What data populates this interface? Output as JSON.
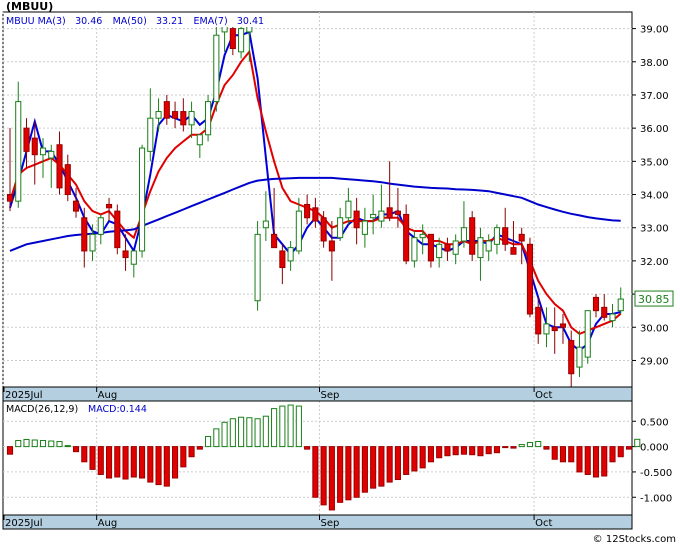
{
  "ticker": "(MBUU)",
  "copyright": "© 12Stocks.com",
  "price_legend": {
    "symbol": "MBUU",
    "ma3_label": "MA(3)",
    "ma3_value": "30.46",
    "ma50_label": "MA(50)",
    "ma50_value": "33.21",
    "ema7_label": "EMA(7)",
    "ema7_value": "30.41"
  },
  "macd_legend": {
    "params": "MACD(26,12,9)",
    "value": "MACD:0.144"
  },
  "last_price_label": "30.85",
  "colors": {
    "up": "#1a7f1a",
    "down": "#e00000",
    "ma3": "#0000dd",
    "ema7": "#e00000",
    "ma50": "#0000cc",
    "axis_band": "#b3cfe0",
    "grid": "#cccccc",
    "frame": "#000000"
  },
  "chart_data": [
    {
      "type": "candlestick",
      "title": "MBUU",
      "ylim": [
        28.2,
        39.5
      ],
      "y_ticks": [
        "29.00",
        "30.00",
        "31.00",
        "32.00",
        "33.00",
        "34.00",
        "35.00",
        "36.00",
        "37.00",
        "38.00",
        "39.00"
      ],
      "x_tick_labels": [
        {
          "label": "2025Jul",
          "index": 0
        },
        {
          "label": "Aug",
          "index": 11
        },
        {
          "label": "Sep",
          "index": 38
        },
        {
          "label": "Oct",
          "index": 64
        }
      ],
      "candles": [
        [
          34.0,
          36.0,
          33.5,
          33.8
        ],
        [
          33.8,
          37.4,
          33.6,
          36.8
        ],
        [
          36.0,
          36.3,
          34.8,
          35.3
        ],
        [
          35.7,
          36.2,
          34.3,
          35.2
        ],
        [
          35.2,
          35.7,
          34.5,
          35.4
        ],
        [
          35.1,
          35.5,
          34.2,
          35.3
        ],
        [
          35.5,
          35.9,
          34.0,
          34.2
        ],
        [
          34.9,
          35.2,
          33.8,
          34.0
        ],
        [
          33.8,
          34.2,
          33.3,
          33.5
        ],
        [
          33.3,
          33.6,
          31.8,
          32.3
        ],
        [
          32.3,
          33.1,
          32.0,
          32.8
        ],
        [
          32.8,
          33.4,
          32.5,
          33.3
        ],
        [
          33.7,
          33.9,
          33.2,
          33.6
        ],
        [
          33.5,
          33.7,
          32.2,
          32.4
        ],
        [
          32.3,
          32.8,
          31.7,
          32.1
        ],
        [
          31.9,
          32.3,
          31.5,
          32.3
        ],
        [
          32.3,
          35.5,
          32.1,
          35.4
        ],
        [
          35.3,
          37.2,
          35.0,
          36.3
        ],
        [
          36.3,
          36.9,
          35.9,
          36.5
        ],
        [
          36.8,
          37.0,
          36.1,
          36.3
        ],
        [
          36.5,
          36.8,
          36.0,
          36.3
        ],
        [
          36.5,
          36.9,
          35.9,
          36.1
        ],
        [
          36.1,
          36.8,
          35.7,
          36.5
        ],
        [
          35.5,
          35.8,
          35.1,
          35.8
        ],
        [
          35.8,
          37.0,
          35.6,
          36.8
        ],
        [
          36.8,
          39.2,
          36.5,
          38.8
        ],
        [
          38.9,
          39.2,
          38.3,
          39.1
        ],
        [
          39.0,
          39.1,
          38.2,
          38.4
        ],
        [
          38.3,
          39.1,
          38.1,
          39.0
        ],
        [
          38.9,
          39.4,
          38.0,
          39.2
        ],
        [
          30.8,
          33.2,
          30.5,
          32.8
        ],
        [
          33.0,
          34.1,
          32.6,
          33.2
        ],
        [
          32.8,
          34.2,
          32.5,
          32.4
        ],
        [
          32.3,
          32.5,
          31.3,
          31.8
        ],
        [
          32.0,
          32.6,
          31.7,
          32.4
        ],
        [
          32.3,
          33.9,
          32.2,
          33.5
        ],
        [
          33.7,
          34.0,
          33.1,
          33.3
        ],
        [
          33.6,
          33.9,
          33.0,
          33.2
        ],
        [
          33.3,
          33.5,
          32.4,
          32.6
        ],
        [
          32.6,
          33.2,
          31.4,
          32.3
        ],
        [
          32.7,
          33.6,
          32.6,
          33.3
        ],
        [
          33.3,
          34.2,
          33.1,
          33.8
        ],
        [
          33.5,
          33.9,
          32.5,
          33.0
        ],
        [
          32.8,
          33.6,
          32.4,
          33.2
        ],
        [
          33.3,
          34.0,
          32.8,
          33.4
        ],
        [
          33.2,
          34.3,
          33.0,
          33.5
        ],
        [
          33.6,
          35.0,
          33.2,
          33.3
        ],
        [
          33.5,
          34.2,
          33.0,
          33.4
        ],
        [
          33.4,
          33.7,
          31.9,
          32.0
        ],
        [
          32.0,
          32.9,
          31.8,
          32.7
        ],
        [
          32.7,
          33.1,
          32.2,
          32.8
        ],
        [
          32.8,
          32.6,
          31.8,
          32.0
        ],
        [
          32.1,
          32.7,
          31.8,
          32.5
        ],
        [
          32.5,
          32.7,
          32.0,
          32.3
        ],
        [
          32.2,
          32.8,
          31.9,
          32.6
        ],
        [
          32.6,
          33.8,
          32.4,
          33.0
        ],
        [
          33.3,
          33.5,
          32.0,
          32.2
        ],
        [
          32.1,
          33.0,
          31.4,
          32.7
        ],
        [
          32.3,
          32.8,
          32.0,
          32.6
        ],
        [
          32.5,
          33.1,
          32.2,
          33.0
        ],
        [
          33.0,
          33.6,
          32.3,
          32.5
        ],
        [
          32.4,
          33.2,
          32.2,
          32.2
        ],
        [
          32.8,
          33.0,
          31.9,
          32.6
        ],
        [
          32.5,
          32.7,
          30.3,
          30.4
        ],
        [
          30.6,
          30.9,
          29.5,
          29.8
        ],
        [
          29.8,
          30.6,
          29.4,
          30.1
        ],
        [
          30.0,
          30.6,
          29.2,
          29.9
        ],
        [
          30.1,
          30.4,
          29.5,
          30.0
        ],
        [
          29.6,
          29.9,
          28.2,
          28.6
        ],
        [
          28.8,
          29.9,
          28.5,
          29.4
        ],
        [
          29.1,
          30.4,
          28.9,
          30.5
        ],
        [
          30.9,
          31.0,
          30.3,
          30.5
        ],
        [
          30.6,
          31.0,
          30.2,
          30.3
        ],
        [
          30.2,
          30.7,
          30.0,
          30.4
        ],
        [
          30.5,
          31.2,
          30.4,
          30.85
        ]
      ],
      "series": [
        {
          "name": "MA(3)",
          "values": [
            33.6,
            34.4,
            35.3,
            36.2,
            35.3,
            35.3,
            34.9,
            34.4,
            33.9,
            33.3,
            32.9,
            32.8,
            33.2,
            33.1,
            32.7,
            32.3,
            33.3,
            34.6,
            36.1,
            36.4,
            36.3,
            36.2,
            36.4,
            36.1,
            36.3,
            37.1,
            38.2,
            38.8,
            38.8,
            38.9,
            37.5,
            35.1,
            32.8,
            32.5,
            32.2,
            32.5,
            33.0,
            33.3,
            33.0,
            32.7,
            32.7,
            33.1,
            33.3,
            33.2,
            33.2,
            33.4,
            33.4,
            33.5,
            32.9,
            32.7,
            32.5,
            32.5,
            32.4,
            32.3,
            32.4,
            32.6,
            32.6,
            32.6,
            32.5,
            32.8,
            32.7,
            32.6,
            32.5,
            31.7,
            30.9,
            30.1,
            30.0,
            30.0,
            29.5,
            29.3,
            29.5,
            30.1,
            30.4,
            30.4,
            30.46
          ]
        },
        {
          "name": "EMA(7)",
          "values": [
            33.8,
            34.6,
            34.8,
            34.9,
            35.0,
            35.1,
            34.9,
            34.6,
            34.3,
            33.8,
            33.5,
            33.4,
            33.5,
            33.2,
            32.9,
            32.7,
            33.4,
            34.1,
            34.7,
            35.1,
            35.4,
            35.6,
            35.8,
            35.8,
            36.0,
            36.7,
            37.3,
            37.6,
            38.0,
            38.3,
            36.9,
            35.9,
            35.0,
            34.2,
            33.8,
            33.7,
            33.6,
            33.5,
            33.3,
            33.0,
            33.1,
            33.2,
            33.2,
            33.2,
            33.2,
            33.3,
            33.3,
            33.3,
            33.0,
            32.9,
            32.9,
            32.6,
            32.6,
            32.5,
            32.5,
            32.6,
            32.5,
            32.6,
            32.6,
            32.7,
            32.6,
            32.5,
            32.5,
            32.0,
            31.4,
            31.0,
            30.7,
            30.5,
            30.0,
            29.8,
            29.9,
            30.0,
            30.1,
            30.2,
            30.41
          ]
        },
        {
          "name": "MA(50)",
          "values": [
            32.3,
            32.4,
            32.5,
            32.55,
            32.6,
            32.65,
            32.7,
            32.75,
            32.78,
            32.8,
            32.82,
            32.84,
            32.88,
            32.9,
            32.92,
            32.95,
            33.05,
            33.15,
            33.25,
            33.35,
            33.45,
            33.55,
            33.65,
            33.75,
            33.85,
            33.95,
            34.05,
            34.15,
            34.25,
            34.35,
            34.42,
            34.45,
            34.47,
            34.48,
            34.49,
            34.5,
            34.5,
            34.5,
            34.5,
            34.5,
            34.48,
            34.46,
            34.44,
            34.42,
            34.4,
            34.37,
            34.33,
            34.3,
            34.27,
            34.24,
            34.22,
            34.2,
            34.19,
            34.18,
            34.16,
            34.15,
            34.14,
            34.12,
            34.1,
            34.05,
            34.0,
            33.95,
            33.9,
            33.8,
            33.7,
            33.62,
            33.55,
            33.48,
            33.42,
            33.37,
            33.32,
            33.28,
            33.25,
            33.22,
            33.21
          ]
        }
      ]
    },
    {
      "type": "bar",
      "title": "MACD(26,12,9)",
      "ylim": [
        -1.35,
        0.9
      ],
      "y_ticks": [
        "0.500",
        "0.000",
        "-0.500",
        "-1.000"
      ],
      "x_tick_labels": [
        {
          "label": "2025Jul",
          "index": 0
        },
        {
          "label": "Aug",
          "index": 11
        },
        {
          "label": "Sep",
          "index": 38
        },
        {
          "label": "Oct",
          "index": 64
        }
      ],
      "values": [
        -0.15,
        0.12,
        0.14,
        0.13,
        0.12,
        0.11,
        0.1,
        0.02,
        -0.1,
        -0.3,
        -0.45,
        -0.55,
        -0.62,
        -0.6,
        -0.64,
        -0.6,
        -0.62,
        -0.7,
        -0.75,
        -0.78,
        -0.62,
        -0.4,
        -0.2,
        -0.05,
        0.2,
        0.35,
        0.48,
        0.55,
        0.58,
        0.57,
        0.55,
        0.6,
        0.75,
        0.8,
        0.82,
        0.8,
        -0.05,
        -1.0,
        -1.15,
        -1.25,
        -1.1,
        -1.05,
        -1.0,
        -0.9,
        -0.82,
        -0.78,
        -0.7,
        -0.65,
        -0.55,
        -0.48,
        -0.42,
        -0.3,
        -0.22,
        -0.18,
        -0.16,
        -0.15,
        -0.16,
        -0.18,
        -0.14,
        -0.12,
        -0.02,
        -0.03,
        0.04,
        0.08,
        0.1,
        -0.05,
        -0.25,
        -0.3,
        -0.3,
        -0.5,
        -0.55,
        -0.6,
        -0.58,
        -0.3,
        -0.2,
        -0.05,
        0.144
      ]
    }
  ]
}
